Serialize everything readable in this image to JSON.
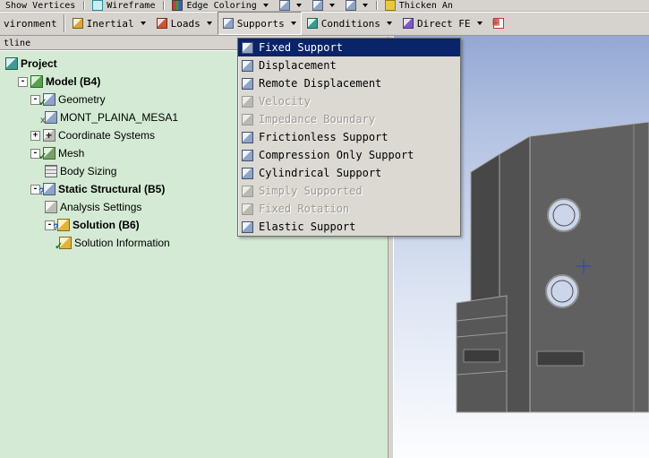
{
  "colors": {
    "selection": "#0a246a",
    "toolbar_bg": "#d6d3ce",
    "tree_bg": "#d4ead4",
    "viewport_top": "#93a8d4",
    "viewport_bottom": "#fcfdff",
    "part_gray": "#5c5c5c"
  },
  "toolbar_top": {
    "show_vertices": "Show Vertices",
    "wireframe": "Wireframe",
    "edge_coloring": "Edge Coloring",
    "thicken": "Thicken An"
  },
  "toolbar_env": {
    "label": "vironment",
    "inertial": "Inertial",
    "loads": "Loads",
    "supports": "Supports",
    "conditions": "Conditions",
    "direct_fe": "Direct FE"
  },
  "outline": {
    "header": "tline"
  },
  "tree": {
    "rows": [
      {
        "label": "Project"
      },
      {
        "label": "Model (B4)"
      },
      {
        "label": "Geometry"
      },
      {
        "label": "MONT_PLAINA_MESA1"
      },
      {
        "label": "Coordinate Systems"
      },
      {
        "label": "Mesh"
      },
      {
        "label": "Body Sizing"
      },
      {
        "label": "Static Structural (B5)"
      },
      {
        "label": "Analysis Settings"
      },
      {
        "label": "Solution (B6)"
      },
      {
        "label": "Solution Information"
      }
    ]
  },
  "menu": {
    "parent_button": "Supports",
    "items": [
      {
        "label": "Fixed Support",
        "enabled": true,
        "selected": true
      },
      {
        "label": "Displacement",
        "enabled": true,
        "selected": false
      },
      {
        "label": "Remote Displacement",
        "enabled": true,
        "selected": false
      },
      {
        "label": "Velocity",
        "enabled": false,
        "selected": false
      },
      {
        "label": "Impedance Boundary",
        "enabled": false,
        "selected": false
      },
      {
        "label": "Frictionless Support",
        "enabled": true,
        "selected": false
      },
      {
        "label": "Compression Only Support",
        "enabled": true,
        "selected": false
      },
      {
        "label": "Cylindrical Support",
        "enabled": true,
        "selected": false
      },
      {
        "label": "Simply Supported",
        "enabled": false,
        "selected": false
      },
      {
        "label": "Fixed Rotation",
        "enabled": false,
        "selected": false
      },
      {
        "label": "Elastic Support",
        "enabled": true,
        "selected": false
      }
    ]
  }
}
